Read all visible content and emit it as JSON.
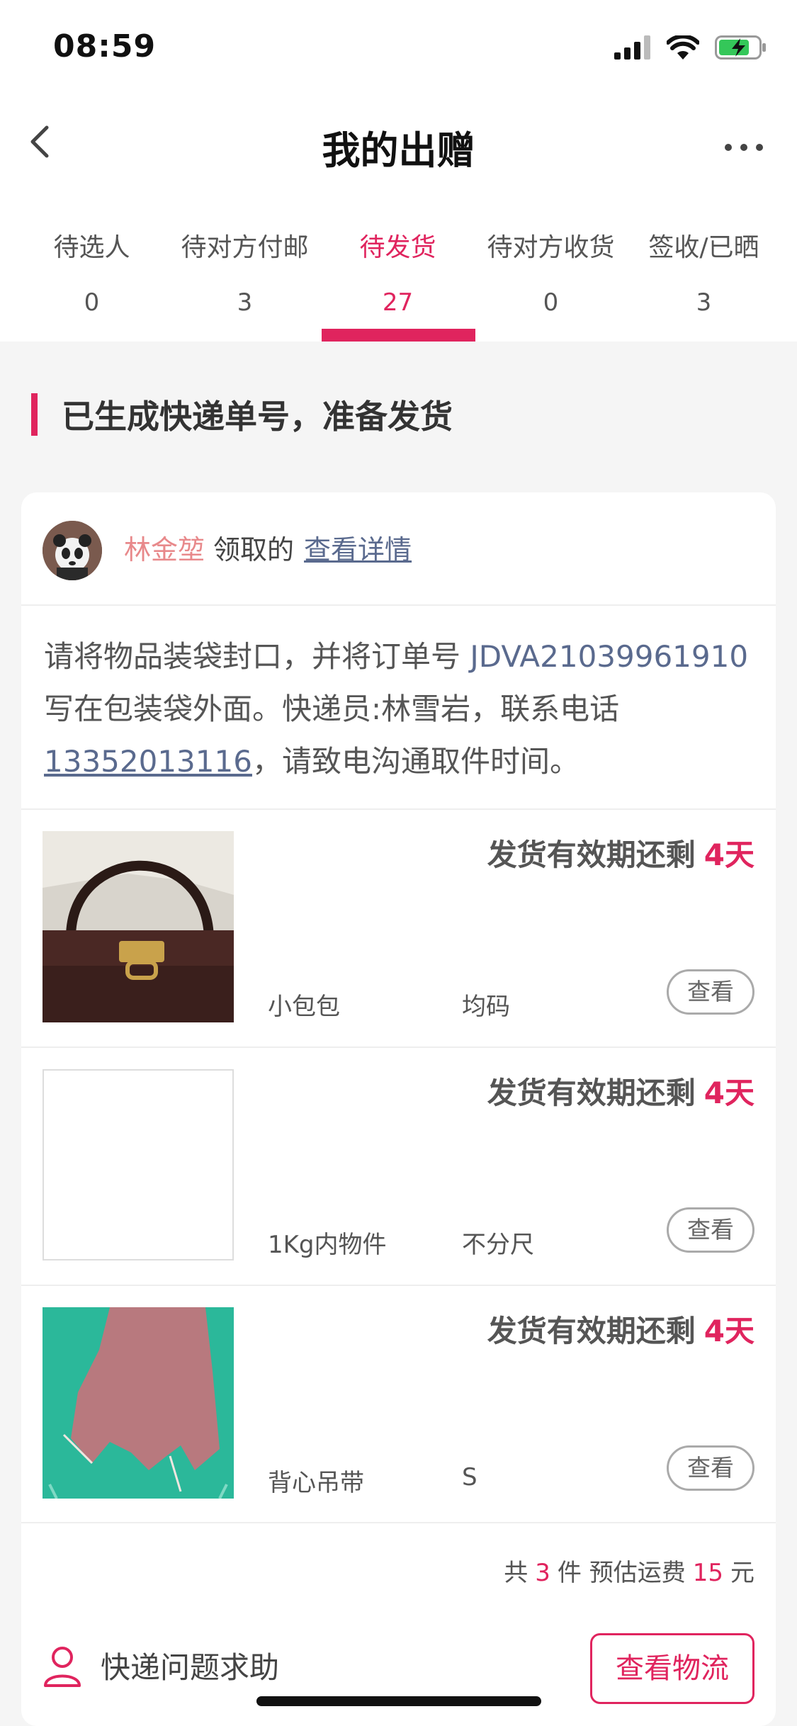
{
  "status_bar": {
    "time": "08:59"
  },
  "header": {
    "title": "我的出赠"
  },
  "tabs": [
    {
      "label": "待选人",
      "count": "0"
    },
    {
      "label": "待对方付邮",
      "count": "3"
    },
    {
      "label": "待发货",
      "count": "27",
      "active": true
    },
    {
      "label": "待对方收货",
      "count": "0"
    },
    {
      "label": "签收/已晒",
      "count": "3"
    }
  ],
  "section": {
    "title": "已生成快递单号，准备发货"
  },
  "order": {
    "receiver_name": "林金堃",
    "receiver_suffix": "领取的",
    "detail_link": "查看详情",
    "instruction": {
      "part1": "请将物品装袋封口，并将订单号 ",
      "order_no": "JDVA21039961910",
      "part2": " 写在包装袋外面。快递员:林雪岩，联系电话",
      "phone": "13352013116",
      "part3": "，请致电沟通取件时间。"
    },
    "items": [
      {
        "deadline_label": "发货有效期还剩",
        "days": "4天",
        "name": "小包包",
        "size": "均码",
        "button": "查看"
      },
      {
        "deadline_label": "发货有效期还剩",
        "days": "4天",
        "name": "1Kg内物件",
        "size": "不分尺",
        "button": "查看"
      },
      {
        "deadline_label": "发货有效期还剩",
        "days": "4天",
        "name": "背心吊带",
        "size": "S",
        "button": "查看"
      }
    ],
    "summary": {
      "prefix": "共",
      "count": "3",
      "unit": "件 预估运费",
      "fee": "15",
      "currency": "元"
    },
    "help_label": "快递问题求助",
    "logistics_button": "查看物流"
  },
  "colors": {
    "accent": "#e0245e",
    "link": "#5a6a8e",
    "name": "#e8898b"
  }
}
